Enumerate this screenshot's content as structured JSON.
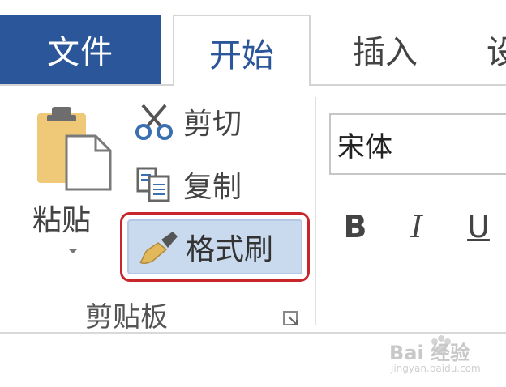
{
  "tabs": {
    "file": "文件",
    "home": "开始",
    "insert": "插入",
    "next": "设"
  },
  "clipboard": {
    "paste_label": "粘贴",
    "cut_label": "剪切",
    "copy_label": "复制",
    "format_painter_label": "格式刷",
    "group_label": "剪贴板"
  },
  "font": {
    "name": "宋体",
    "bold": "B",
    "italic": "I",
    "underline": "U"
  },
  "watermark": {
    "text": "Bai 经验",
    "sub": "jingyan.baidu.com"
  },
  "colors": {
    "file_tab": "#2b579a",
    "highlight_border": "#c8262b",
    "selected_fill": "#c9d9ee"
  }
}
